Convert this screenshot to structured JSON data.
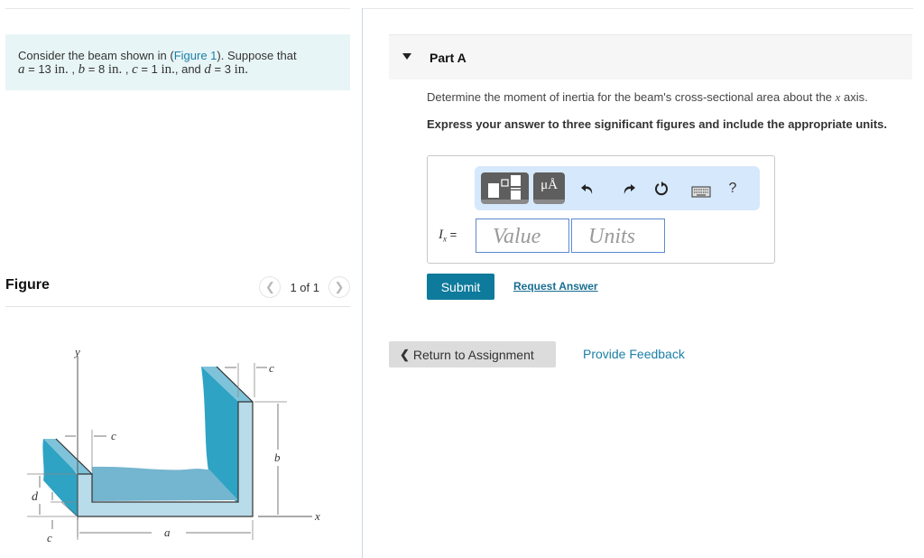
{
  "problem": {
    "intro": "Consider the beam shown in (",
    "figure_link": "Figure 1",
    "intro_end": "). Suppose that",
    "vars": [
      {
        "name": "a",
        "eq": " = 13 ",
        "unit": "in.",
        "sep": " , "
      },
      {
        "name": "b",
        "eq": " = 8 ",
        "unit": "in.",
        "sep": " , "
      },
      {
        "name": "c",
        "eq": " = 1 ",
        "unit": "in.",
        "sep": ", and "
      },
      {
        "name": "d",
        "eq": " = 3 ",
        "unit": "in.",
        "sep": ""
      }
    ]
  },
  "figure": {
    "title": "Figure",
    "pager_text": "1 of 1",
    "prev_icon": "chevron-left",
    "next_icon": "chevron-right",
    "labels": {
      "y": "y",
      "x": "x",
      "a": "a",
      "b": "b",
      "c": "c",
      "d": "d"
    },
    "colors": {
      "dark_face": "#2ea3c3",
      "top_face": "#7fc3da",
      "floor": "#74b5cf",
      "section": "#b9dcea",
      "outline": "#333333"
    }
  },
  "part": {
    "title": "Part A",
    "question_pre": "Determine the moment of inertia for the beam's cross-sectional area about the ",
    "question_var": "x",
    "question_post": " axis.",
    "instruction": "Express your answer to three significant figures and include the appropriate units."
  },
  "answer": {
    "label_var": "I",
    "label_sub": "x",
    "label_eq": " =",
    "value_placeholder": "Value",
    "units_placeholder": "Units",
    "toolbar": {
      "units_label": "μÅ",
      "help_label": "?"
    }
  },
  "actions": {
    "submit": "Submit",
    "request_answer": "Request Answer",
    "return": "Return to Assignment",
    "feedback": "Provide Feedback"
  },
  "colors": {
    "accent": "#0e7a9c",
    "link": "#1a7fa6",
    "problem_bg": "#e8f5f7",
    "toolbar_bg": "#d6e8fb"
  }
}
